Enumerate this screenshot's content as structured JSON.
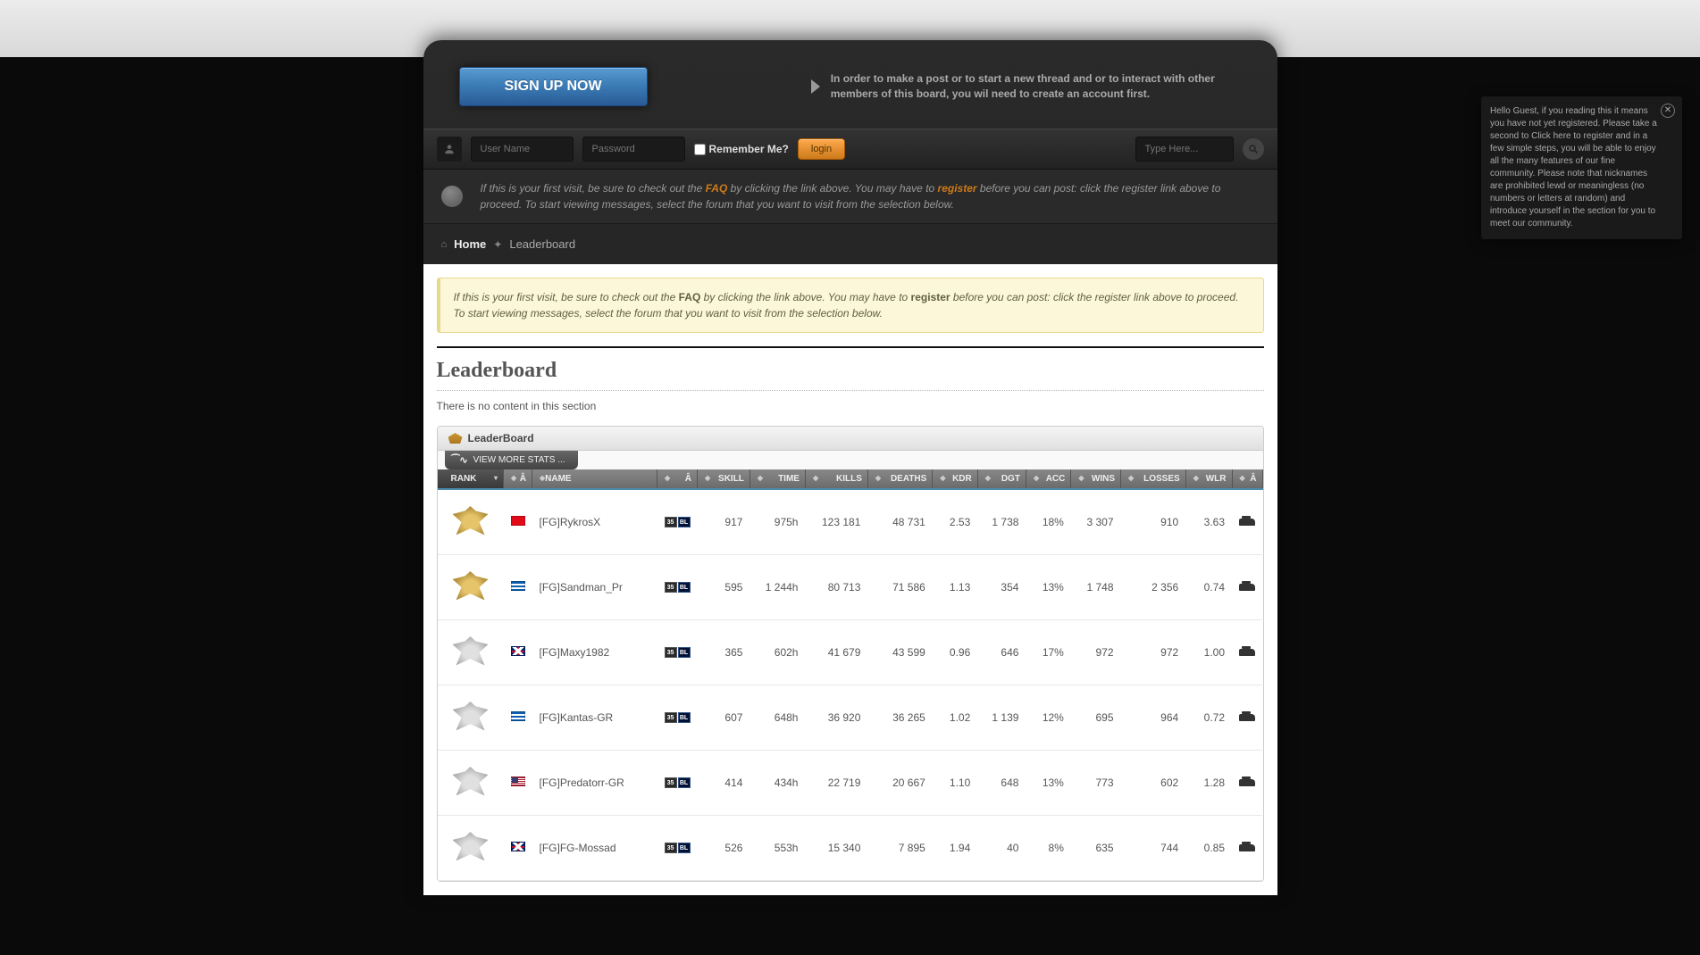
{
  "header": {
    "signup_button": "SIGN UP NOW",
    "signup_notice": "In order to make a post or to start a new thread and or to interact with other members of this board, you wil need to create an account first."
  },
  "login": {
    "username_placeholder": "User Name",
    "password_placeholder": "Password",
    "remember_label": "Remember Me?",
    "login_button": "login",
    "search_placeholder": "Type Here..."
  },
  "info_bar": {
    "prefix": "If this is your first visit, be sure to check out the ",
    "faq": "FAQ",
    "mid1": " by clicking the link above. You may have to ",
    "register": "register",
    "suffix": " before you can post: click the register link above to proceed. To start viewing messages, select the forum that you want to visit from the selection below."
  },
  "breadcrumb": {
    "home": "Home",
    "current": "Leaderboard"
  },
  "notice_box": {
    "prefix": "If this is your first visit, be sure to check out the ",
    "faq": "FAQ",
    "mid1": " by clicking the link above. You may have to ",
    "register": "register",
    "suffix": " before you can post: click the register link above to proceed. To start viewing messages, select the forum that you want to visit from the selection below."
  },
  "page": {
    "title": "Leaderboard",
    "no_content": "There is no content in this section"
  },
  "leaderboard": {
    "panel_title": "LeaderBoard",
    "view_more": "VIEW MORE STATS ...",
    "columns": {
      "rank": "RANK",
      "flag": "Â",
      "name": "NAME",
      "badge": "Â",
      "skill": "SKILL",
      "time": "TIME",
      "kills": "KILLS",
      "deaths": "DEATHS",
      "kdr": "KDR",
      "dgt": "DGT",
      "acc": "ACC",
      "wins": "WINS",
      "losses": "LOSSES",
      "wlr": "WLR",
      "tank": "Â"
    },
    "rows": [
      {
        "rank_tier": "gold",
        "flag": "tr",
        "name": "[FG]RykrosX",
        "skill": "917",
        "time": "975h",
        "kills": "123 181",
        "deaths": "48 731",
        "kdr": "2.53",
        "dgt": "1 738",
        "acc": "18%",
        "wins": "3 307",
        "losses": "910",
        "wlr": "3.63"
      },
      {
        "rank_tier": "gold",
        "flag": "gr",
        "name": "[FG]Sandman_Pr",
        "skill": "595",
        "time": "1 244h",
        "kills": "80 713",
        "deaths": "71 586",
        "kdr": "1.13",
        "dgt": "354",
        "acc": "13%",
        "wins": "1 748",
        "losses": "2 356",
        "wlr": "0.74"
      },
      {
        "rank_tier": "silver",
        "flag": "gb",
        "name": "[FG]Maxy1982",
        "skill": "365",
        "time": "602h",
        "kills": "41 679",
        "deaths": "43 599",
        "kdr": "0.96",
        "dgt": "646",
        "acc": "17%",
        "wins": "972",
        "losses": "972",
        "wlr": "1.00"
      },
      {
        "rank_tier": "silver",
        "flag": "gr",
        "name": "[FG]Kantas-GR",
        "skill": "607",
        "time": "648h",
        "kills": "36 920",
        "deaths": "36 265",
        "kdr": "1.02",
        "dgt": "1 139",
        "acc": "12%",
        "wins": "695",
        "losses": "964",
        "wlr": "0.72"
      },
      {
        "rank_tier": "silver",
        "flag": "us",
        "name": "[FG]Predatorr-GR",
        "skill": "414",
        "time": "434h",
        "kills": "22 719",
        "deaths": "20 667",
        "kdr": "1.10",
        "dgt": "648",
        "acc": "13%",
        "wins": "773",
        "losses": "602",
        "wlr": "1.28"
      },
      {
        "rank_tier": "silver",
        "flag": "gb",
        "name": "[FG]FG-Mossad",
        "skill": "526",
        "time": "553h",
        "kills": "15 340",
        "deaths": "7 895",
        "kdr": "1.94",
        "dgt": "40",
        "acc": "8%",
        "wins": "635",
        "losses": "744",
        "wlr": "0.85"
      }
    ]
  },
  "popup": {
    "text": "Hello Guest, if you reading this it means you have not yet registered. Please take a second to Click here to register and in a few simple steps, you will be able to enjoy all the many features of our fine community. Please note that nicknames are prohibited lewd or meaningless (no numbers or letters at random) and introduce yourself in the section for you to meet our community."
  }
}
